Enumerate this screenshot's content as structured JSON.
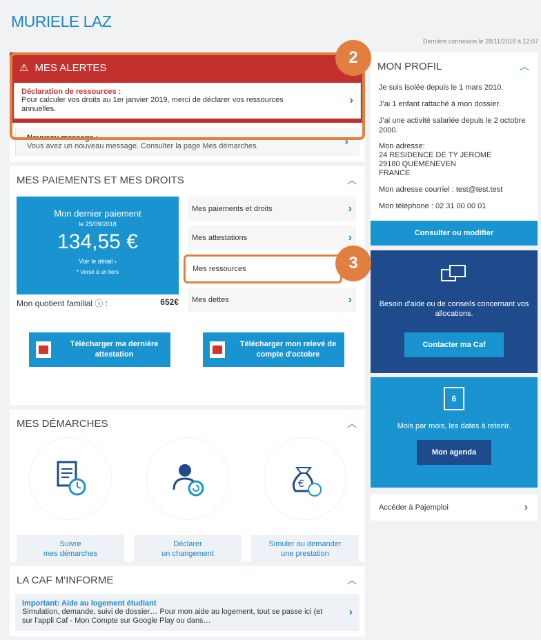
{
  "header": {
    "title": "MURIELE LAZ",
    "last_login": "Dernière connexion le 28/11/2018 à 12:07"
  },
  "alerts": {
    "title": "MES ALERTES",
    "badge": "2",
    "item_title": "Déclaration de ressources :",
    "item_text": "Pour calculer vos droits au 1er janvier 2019, merci de déclarer vos ressources annuelles.",
    "message_title": "Nouveau message :",
    "message_text": "Vous avez un nouveau message. Consulter la page Mes démarches."
  },
  "payments": {
    "title": "MES PAIEMENTS ET MES DROITS",
    "tile_title": "Mon dernier paiement",
    "tile_date": "le 25/09/2018",
    "amount": "134,55 €",
    "detail": "Voir le détail",
    "versed": "* Versé à un tiers",
    "quotient_label": "Mon quotient familial",
    "quotient_value": "652€",
    "links": [
      "Mes paiements et droits",
      "Mes attestations",
      "Mes ressources",
      "Mes dettes"
    ],
    "badge": "3",
    "download1": "Télécharger ma dernière attestation",
    "download2": "Télécharger mon relevé de compte d'octobre"
  },
  "demarches": {
    "title": "MES DÉMARCHES",
    "items": [
      {
        "line1": "Suivre",
        "line2": "mes démarches"
      },
      {
        "line1": "Déclarer",
        "line2": "un changement"
      },
      {
        "line1": "Simuler ou demander",
        "line2": "une prestation"
      }
    ]
  },
  "info": {
    "title": "LA CAF M'INFORME",
    "item_title": "Important: Aide au logement étudiant",
    "item_text": "Simulation, demande, suivi de dossier… Pour mon aide au logement, tout se passe ici (et sur l'appli Caf - Mon Compte sur Google Play ou dans…"
  },
  "profile": {
    "title": "MON PROFIL",
    "lines": [
      "Je suis isolée depuis le 1 mars 2010.",
      "J'ai 1 enfant rattaché à mon dossier.",
      "J'ai une activité salariée depuis le 2 octobre 2000."
    ],
    "address_label": "Mon adresse:",
    "address_lines": [
      "24 RESIDENCE DE TY JEROME",
      "29180 QUEMENEVEN",
      "FRANCE"
    ],
    "email": "Mon adresse courriel : test@test.test",
    "phone": "Mon téléphone : 02 31 00 00 01",
    "button": "Consulter ou modifier"
  },
  "help": {
    "text": "Besoin d'aide ou de conseils concernant vos allocations.",
    "button": "Contacter ma Caf"
  },
  "agenda": {
    "day": "6",
    "text": "Mois par mois, les dates à retenir.",
    "button": "Mon agenda"
  },
  "pajemploi": {
    "label": "Accéder à Pajemploi"
  }
}
